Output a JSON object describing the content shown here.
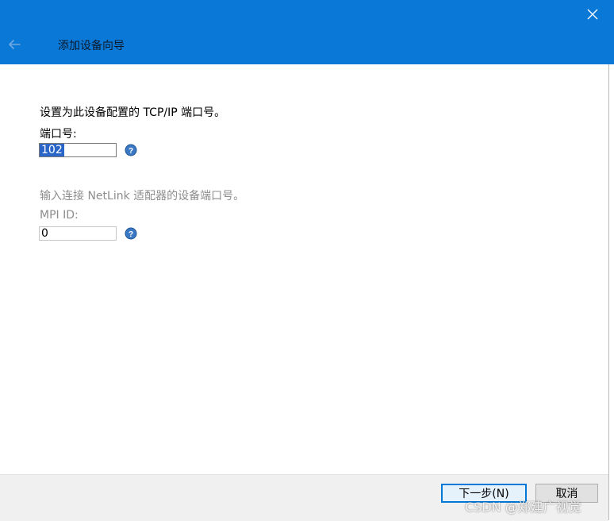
{
  "window": {
    "title": "添加设备向导",
    "accent_color": "#0a78d7"
  },
  "icons": {
    "back": "arrow-left-icon",
    "close": "close-icon",
    "help": "help-circle-icon"
  },
  "port_section": {
    "description": "设置为此设备配置的 TCP/IP 端口号。",
    "label": "端口号:",
    "value": "102"
  },
  "mpi_section": {
    "description": "输入连接 NetLink 适配器的设备端口号。",
    "label": "MPI ID:",
    "value": "0"
  },
  "footer": {
    "next_label": "下一步(N)",
    "cancel_label": "取消"
  },
  "watermark": "CSDN @郑建广视觉"
}
